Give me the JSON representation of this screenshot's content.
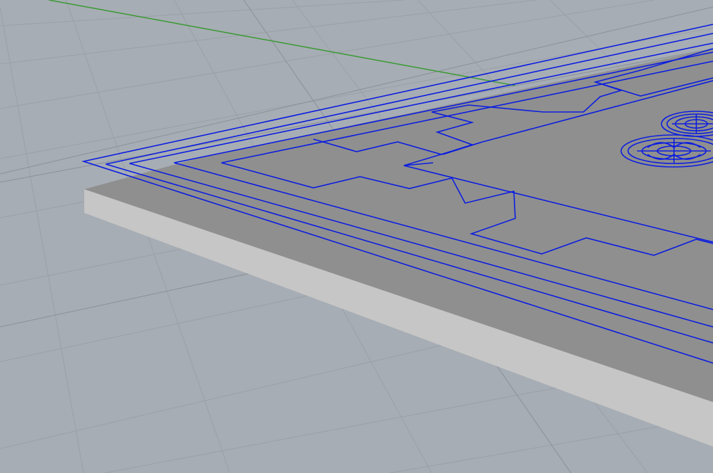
{
  "viewport": {
    "view": "Perspective",
    "display_mode": "shaded",
    "background": "#a7adb4",
    "grid": {
      "visible": true,
      "minor_color": "#9aa0a7",
      "major_color": "#8b9097",
      "axis_y_color": "#3f9a3a"
    }
  },
  "model": {
    "panel": {
      "top_color": "#8f8f8f",
      "side_color": "#c8c8c8",
      "front_color": "#b9b9b9"
    },
    "selection": {
      "state": "selected",
      "curve_color": "#0b1de0",
      "curve_count": 5
    },
    "ornaments": {
      "type": "rosette",
      "count": 2
    }
  }
}
